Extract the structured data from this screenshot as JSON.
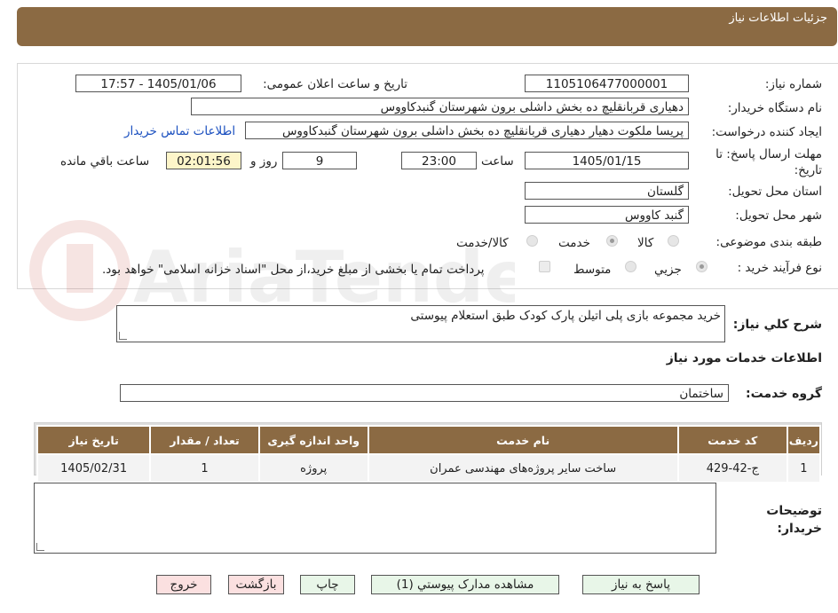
{
  "header": {
    "title": "جزئیات اطلاعات نیاز"
  },
  "fields": {
    "need_number_label": "شماره نیاز:",
    "need_number": "1105106477000001",
    "announce_label": "تاریخ و ساعت اعلان عمومی:",
    "announce_value": "1405/01/06 - 17:57",
    "buyer_org_label": "نام دستگاه خریدار:",
    "buyer_org": "دهیاری قربانقلیچ ده بخش داشلی برون شهرستان گنبدکاووس",
    "creator_label": "ایجاد کننده درخواست:",
    "creator": "پریسا ملکوت دهیار  دهیاری قربانقلیچ ده بخش داشلی برون شهرستان گنبدکاووس",
    "contact_link": "اطلاعات تماس خریدار",
    "deadline_label": "مهلت ارسال پاسخ: تا تاریخ:",
    "deadline_date": "1405/01/15",
    "time_label": "ساعت",
    "deadline_time": "23:00",
    "days_value": "9",
    "days_label": "روز و",
    "remaining_value": "02:01:56",
    "remaining_label": "ساعت باقي مانده",
    "province_label": "استان محل تحویل:",
    "province": "گلستان",
    "city_label": "شهر محل تحویل:",
    "city": "گنبد کاووس",
    "category_label": "طبقه بندی موضوعی:",
    "category_options": [
      "کالا",
      "خدمت",
      "کالا/خدمت"
    ],
    "process_label": "نوع فرآیند خرید :",
    "process_options": [
      "جزيي",
      "متوسط"
    ],
    "payment_note": "پرداخت تمام یا بخشی از مبلغ خرید،از محل \"اسناد خزانه اسلامی\" خواهد بود."
  },
  "summary": {
    "label": "شرح کلي نیاز:",
    "value": "خرید مجموعه بازی پلی اتیلن پارک کودک طبق استعلام پیوستی"
  },
  "services": {
    "section_title": "اطلاعات خدمات مورد نیاز",
    "group_label": "گروه خدمت:",
    "group_value": "ساختمان",
    "columns": [
      "ردیف",
      "کد خدمت",
      "نام خدمت",
      "واحد اندازه گیری",
      "تعداد / مقدار",
      "تاریخ نیاز"
    ],
    "rows": [
      [
        "1",
        "ج-42-429",
        "ساخت سایر پروژه‌های مهندسی عمران",
        "پروژه",
        "1",
        "1405/02/31"
      ]
    ]
  },
  "notes": {
    "label": "توضیحات خریدار:",
    "value": ""
  },
  "buttons": {
    "reply": "پاسخ به نیاز",
    "attachments": "مشاهده مدارک پیوستي (1)",
    "print": "چاپ",
    "back": "بازگشت",
    "exit": "خروج"
  },
  "watermark": {
    "text": "AriaTender.neT"
  },
  "colors": {
    "header_bg": "#8b6a43",
    "link": "#1a4fbf",
    "yellow_box": "#fdf5c9",
    "btn_green": "#e8f6e8",
    "btn_red": "#fbe0e0"
  }
}
